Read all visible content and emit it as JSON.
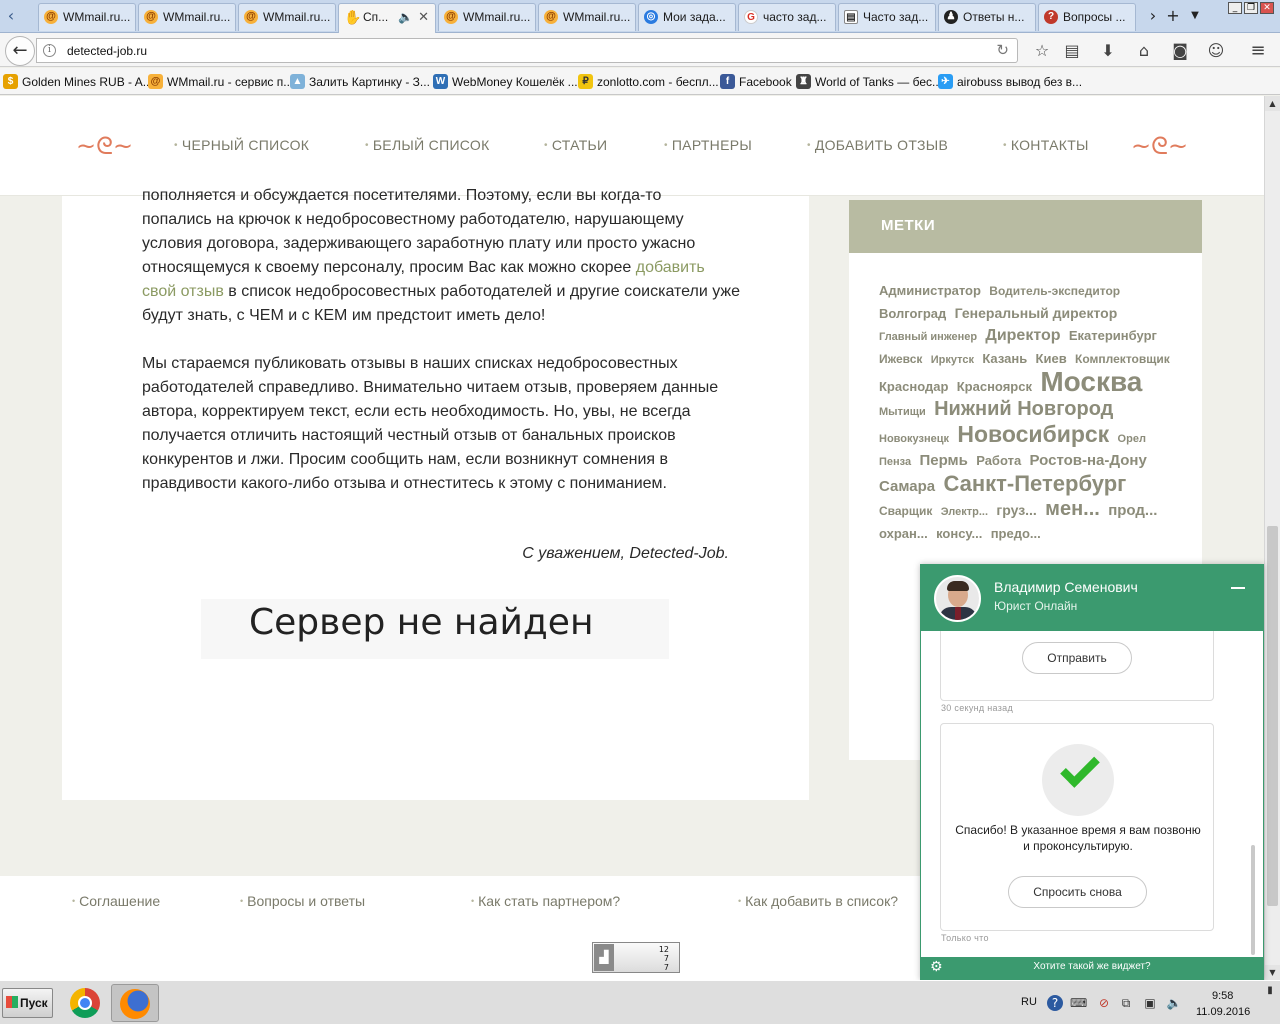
{
  "browser": {
    "tabs": [
      {
        "label": "WMmail.ru...",
        "icon": "wmmail-icon",
        "active": false
      },
      {
        "label": "WMmail.ru...",
        "icon": "wmmail-icon",
        "active": false
      },
      {
        "label": "WMmail.ru...",
        "icon": "wmmail-icon",
        "active": false
      },
      {
        "label": "Сп...",
        "icon": "hand-icon",
        "active": true
      },
      {
        "label": "WMmail.ru...",
        "icon": "wmmail-icon",
        "active": false
      },
      {
        "label": "WMmail.ru...",
        "icon": "wmmail-icon",
        "active": false
      },
      {
        "label": "Мои зада...",
        "icon": "target-icon",
        "active": false
      },
      {
        "label": "часто зад...",
        "icon": "google-icon",
        "active": false
      },
      {
        "label": "Часто зад...",
        "icon": "document-icon",
        "active": false
      },
      {
        "label": "Ответы н...",
        "icon": "answers-icon",
        "active": false
      },
      {
        "label": "Вопросы ...",
        "icon": "questions-icon",
        "active": false
      }
    ],
    "url": "detected-job.ru",
    "bookmarks": [
      {
        "label": "Golden Mines RUB - A...",
        "icon": "golden-mines-icon"
      },
      {
        "label": "WMmail.ru - сервис п...",
        "icon": "wmmail-icon"
      },
      {
        "label": "Залить Картинку - З...",
        "icon": "image-upload-icon"
      },
      {
        "label": "WebMoney Кошелёк ...",
        "icon": "webmoney-icon"
      },
      {
        "label": "zonlotto.com - беспл...",
        "icon": "zonlotto-icon"
      },
      {
        "label": "Facebook",
        "icon": "facebook-icon"
      },
      {
        "label": "World of Tanks — бес...",
        "icon": "world-of-tanks-icon"
      },
      {
        "label": "airobuss вывод без в...",
        "icon": "plane-icon"
      }
    ]
  },
  "site": {
    "menu": [
      "ЧЕРНЫЙ СПИСОК",
      "БЕЛЫЙ СПИСОК",
      "СТАТЬИ",
      "ПАРТНЕРЫ",
      "ДОБАВИТЬ ОТЗЫВ",
      "КОНТАКТЫ"
    ],
    "article": {
      "p1_partial_line": "пополняется и обсуждается посетителями. Поэтому, если вы когда-то",
      "p1_before_link": "попались на крючок к недобросовестному работодателю, нарушающему условия договора, задерживающего заработную плату или просто ужасно относящемуся к своему персоналу, просим Вас как можно скорее ",
      "p1_link": "добавить свой отзыв",
      "p1_after_link": " в список недобросовестных работодателей и другие соискатели уже будут знать, с ЧЕМ и с КЕМ им предстоит иметь дело!",
      "p2": "Мы стараемся публиковать отзывы в наших списках недобросовестных работодателей справедливо. Внимательно читаем отзыв, проверяем данные автора, корректируем текст, если есть необходимость. Но, увы, не всегда получается отличить настоящий честный отзыв от банальных происков конкурентов и лжи. Просим сообщить нам, если возникнут сомнения в правдивости какого-либо отзыва и отнеститесь к этому с пониманием.",
      "signature": "С уважением, Detected-Job.",
      "server_error": "Сервер не найден"
    },
    "sidebar": {
      "title": "МЕТКИ",
      "tags": [
        {
          "text": "Администратор",
          "size": 13
        },
        {
          "text": "Водитель-экспедитор",
          "size": 12
        },
        {
          "text": "Волгоград",
          "size": 13
        },
        {
          "text": "Генеральный директор",
          "size": 14
        },
        {
          "text": "Главный инженер",
          "size": 11
        },
        {
          "text": "Директор",
          "size": 16
        },
        {
          "text": "Екатеринбург",
          "size": 13
        },
        {
          "text": "Ижевск",
          "size": 12
        },
        {
          "text": "Иркутск",
          "size": 11
        },
        {
          "text": "Казань",
          "size": 13
        },
        {
          "text": "Киев",
          "size": 13
        },
        {
          "text": "Комплектовщик",
          "size": 12
        },
        {
          "text": "Краснодар",
          "size": 13
        },
        {
          "text": "Красноярск",
          "size": 13
        },
        {
          "text": "Москва",
          "size": 28
        },
        {
          "text": "Мытищи",
          "size": 11
        },
        {
          "text": "Нижний Новгород",
          "size": 20
        },
        {
          "text": "Новокузнецк",
          "size": 11
        },
        {
          "text": "Новосибирск",
          "size": 23
        },
        {
          "text": "Орел",
          "size": 11
        },
        {
          "text": "Пенза",
          "size": 11
        },
        {
          "text": "Пермь",
          "size": 15
        },
        {
          "text": "Работа",
          "size": 13
        },
        {
          "text": "Ростов-на-Дону",
          "size": 15
        },
        {
          "text": "Самара",
          "size": 15
        },
        {
          "text": "Санкт-Петербург",
          "size": 22
        },
        {
          "text": "Сварщик",
          "size": 12
        },
        {
          "text": "Электр...",
          "size": 11
        },
        {
          "text": "груз...",
          "size": 14
        },
        {
          "text": "мен...",
          "size": 20
        },
        {
          "text": "прод...",
          "size": 15
        },
        {
          "text": "охран...",
          "size": 13
        },
        {
          "text": "консу...",
          "size": 13
        },
        {
          "text": "предо...",
          "size": 13
        }
      ]
    },
    "footer": {
      "links": [
        "Соглашение",
        "Вопросы и ответы",
        "Как стать партнером?",
        "Как добавить в список?"
      ],
      "counter": [
        "12",
        "7",
        "7"
      ]
    }
  },
  "widget": {
    "agent_name": "Владимир Семенович",
    "agent_role": "Юрист Онлайн",
    "send_label": "Отправить",
    "ts1": "30 секунд назад",
    "thanks": "Спасибо! В указанное время я вам позвоню и проконсультирую.",
    "ask_again": "Спросить снова",
    "ts2": "Только что",
    "promo": "Хотите такой же виджет?",
    "accent": "#3b9a6f"
  },
  "taskbar": {
    "start_label": "Пуск",
    "lang": "RU",
    "time": "9:58",
    "date": "11.09.2016"
  }
}
